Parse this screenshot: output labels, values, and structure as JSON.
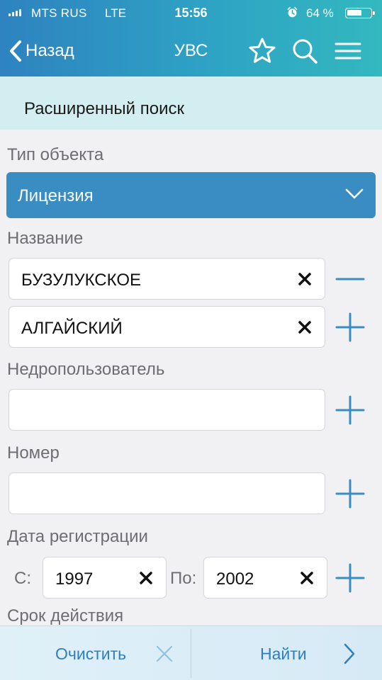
{
  "status_bar": {
    "carrier": "MTS RUS",
    "network": "LTE",
    "time": "15:56",
    "battery_percent": "64 %",
    "battery_level": 0.64,
    "alarm_icon": "alarm-clock-icon"
  },
  "nav": {
    "back_label": "Назад",
    "title": "УВС",
    "icons": [
      "star-icon",
      "search-icon",
      "menu-icon"
    ]
  },
  "section": {
    "title": "Расширенный поиск"
  },
  "form": {
    "object_type": {
      "label": "Тип объекта",
      "value": "Лицензия"
    },
    "name": {
      "label": "Название",
      "values": [
        "БУЗУЛУКСКОЕ",
        "АЛГАЙСКИЙ"
      ]
    },
    "subsoil_user": {
      "label": "Недропользователь",
      "value": ""
    },
    "number": {
      "label": "Номер",
      "value": ""
    },
    "registration_date": {
      "label": "Дата регистрации",
      "from_label": "С:",
      "from_value": "1997",
      "to_label": "По:",
      "to_value": "2002"
    },
    "next_label_cut": "Срок действия"
  },
  "bottom_bar": {
    "clear_label": "Очистить",
    "find_label": "Найти"
  },
  "colors": {
    "header_start": "#2e83c0",
    "header_end": "#33b8bf",
    "accent": "#3a8dc3",
    "band": "#d3eef0",
    "action_blue": "#2f7fbf"
  }
}
